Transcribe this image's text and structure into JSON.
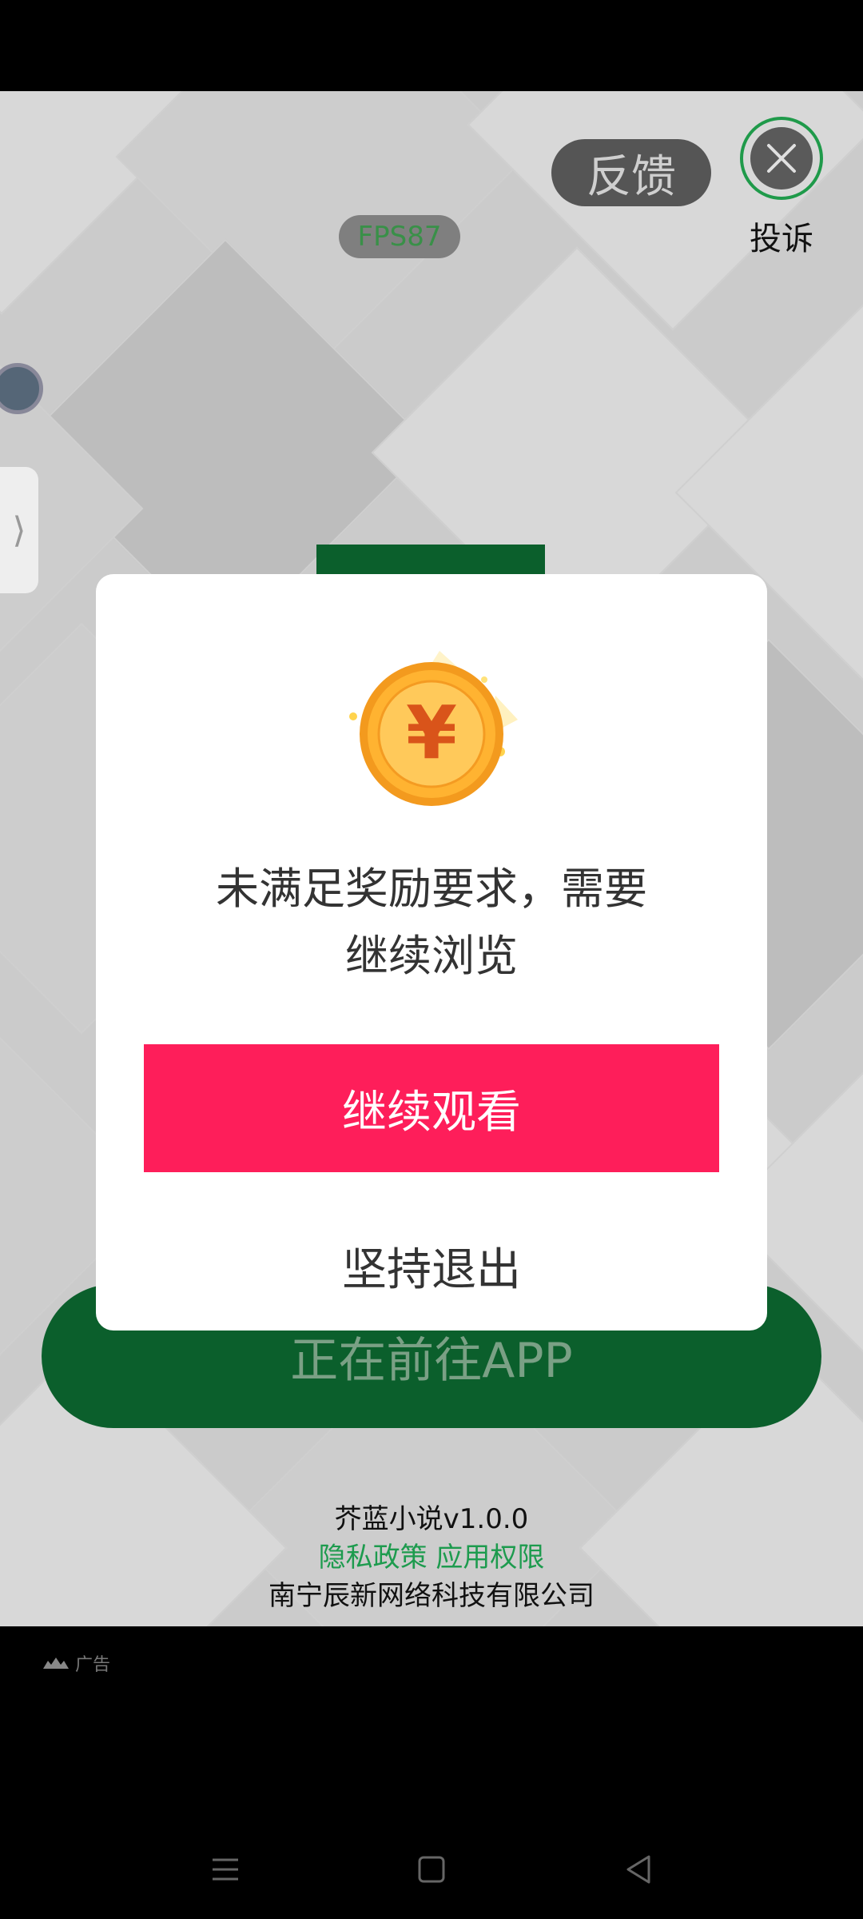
{
  "ad_overlay": {
    "feedback_label": "反馈",
    "complaint_label": "投诉",
    "fps_label": "FPS87",
    "side_handle_icon": "chevron-right-icon",
    "close_icon": "close-icon"
  },
  "landing": {
    "goto_app_label": "正在前往APP",
    "app_name": "芥蓝小说v1.0.0",
    "privacy_label": "隐私政策",
    "permissions_label": "应用权限",
    "company": "南宁辰新网络科技有限公司",
    "link_color": "#1d9b4e",
    "button_color": "#0b5f2c"
  },
  "ad_label": "广告",
  "dialog": {
    "coin_icon": "yuan-coin-icon",
    "message_line1": "未满足奖励要求，需要",
    "message_line2": "继续浏览",
    "continue_label": "继续观看",
    "exit_label": "坚持退出",
    "accent_color": "#fe1e5a"
  },
  "nav_bar": {
    "menu_icon": "menu-icon",
    "home_icon": "home-icon",
    "back_icon": "back-icon"
  }
}
